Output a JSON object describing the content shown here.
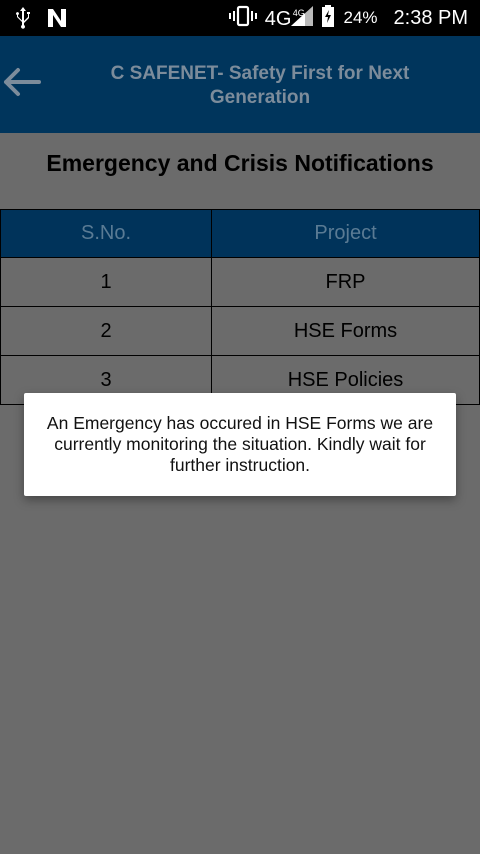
{
  "status_bar": {
    "network": "4G",
    "network_small": "4G",
    "battery_percent": "24%",
    "time": "2:38 PM",
    "icons": [
      "usb-icon",
      "n-notification-icon",
      "vibrate-icon",
      "signal-icon",
      "battery-charging-icon"
    ]
  },
  "app_bar": {
    "title": "C SAFENET- Safety First for Next Generation",
    "back_icon": "back-arrow-icon"
  },
  "page": {
    "title": "Emergency and Crisis Notifications"
  },
  "table": {
    "headers": [
      "S.No.",
      "Project"
    ],
    "rows": [
      [
        "1",
        "FRP"
      ],
      [
        "2",
        "HSE Forms"
      ],
      [
        "3",
        "HSE Policies"
      ]
    ]
  },
  "dialog": {
    "message": "An Emergency has occured in HSE Forms we are currently monitoring the situation. Kindly wait for further instruction."
  },
  "colors": {
    "app_bar": "#00355c",
    "table_header": "#00335a",
    "overlay_bg": "#6b6b6b"
  }
}
